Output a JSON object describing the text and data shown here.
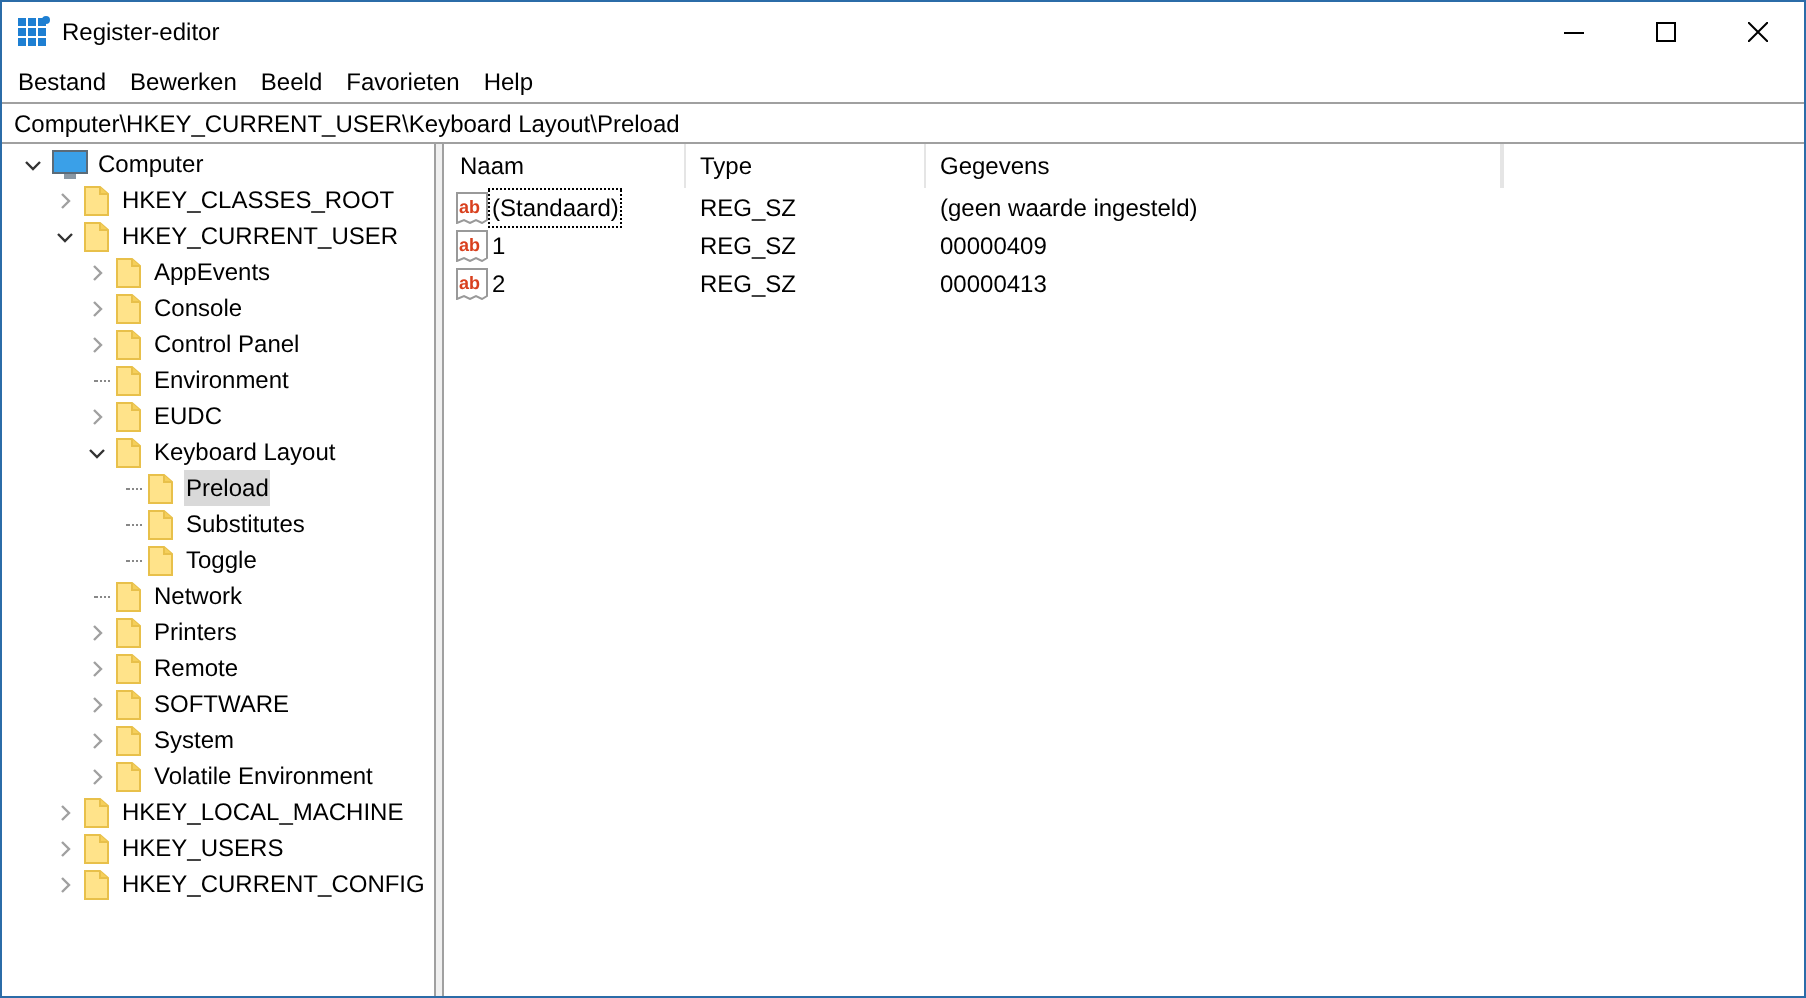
{
  "window": {
    "title": "Register-editor"
  },
  "menu": [
    "Bestand",
    "Bewerken",
    "Beeld",
    "Favorieten",
    "Help"
  ],
  "address": "Computer\\HKEY_CURRENT_USER\\Keyboard Layout\\Preload",
  "tree": [
    {
      "label": "Computer",
      "kind": "computer",
      "expandable": true,
      "expanded": true,
      "selected": false,
      "children": [
        {
          "label": "HKEY_CLASSES_ROOT",
          "kind": "folder",
          "expandable": true,
          "expanded": false,
          "selected": false
        },
        {
          "label": "HKEY_CURRENT_USER",
          "kind": "folder",
          "expandable": true,
          "expanded": true,
          "selected": false,
          "children": [
            {
              "label": "AppEvents",
              "kind": "folder",
              "expandable": true,
              "expanded": false,
              "selected": false
            },
            {
              "label": "Console",
              "kind": "folder",
              "expandable": true,
              "expanded": false,
              "selected": false
            },
            {
              "label": "Control Panel",
              "kind": "folder",
              "expandable": true,
              "expanded": false,
              "selected": false
            },
            {
              "label": "Environment",
              "kind": "folder",
              "expandable": false,
              "selected": false
            },
            {
              "label": "EUDC",
              "kind": "folder",
              "expandable": true,
              "expanded": false,
              "selected": false
            },
            {
              "label": "Keyboard Layout",
              "kind": "folder",
              "expandable": true,
              "expanded": true,
              "selected": false,
              "children": [
                {
                  "label": "Preload",
                  "kind": "folder",
                  "expandable": false,
                  "selected": true
                },
                {
                  "label": "Substitutes",
                  "kind": "folder",
                  "expandable": false,
                  "selected": false
                },
                {
                  "label": "Toggle",
                  "kind": "folder",
                  "expandable": false,
                  "selected": false
                }
              ]
            },
            {
              "label": "Network",
              "kind": "folder",
              "expandable": false,
              "selected": false
            },
            {
              "label": "Printers",
              "kind": "folder",
              "expandable": true,
              "expanded": false,
              "selected": false
            },
            {
              "label": "Remote",
              "kind": "folder",
              "expandable": true,
              "expanded": false,
              "selected": false
            },
            {
              "label": "SOFTWARE",
              "kind": "folder",
              "expandable": true,
              "expanded": false,
              "selected": false
            },
            {
              "label": "System",
              "kind": "folder",
              "expandable": true,
              "expanded": false,
              "selected": false
            },
            {
              "label": "Volatile Environment",
              "kind": "folder",
              "expandable": true,
              "expanded": false,
              "selected": false
            }
          ]
        },
        {
          "label": "HKEY_LOCAL_MACHINE",
          "kind": "folder",
          "expandable": true,
          "expanded": false,
          "selected": false
        },
        {
          "label": "HKEY_USERS",
          "kind": "folder",
          "expandable": true,
          "expanded": false,
          "selected": false
        },
        {
          "label": "HKEY_CURRENT_CONFIG",
          "kind": "folder",
          "expandable": true,
          "expanded": false,
          "selected": false
        }
      ]
    }
  ],
  "table": {
    "columns": [
      "Naam",
      "Type",
      "Gegevens"
    ],
    "rows": [
      {
        "icon": "ab",
        "name": "(Standaard)",
        "type": "REG_SZ",
        "data": "(geen waarde ingesteld)",
        "focused": true
      },
      {
        "icon": "ab",
        "name": "1",
        "type": "REG_SZ",
        "data": "00000409",
        "focused": false
      },
      {
        "icon": "ab",
        "name": "2",
        "type": "REG_SZ",
        "data": "00000413",
        "focused": false
      }
    ]
  }
}
